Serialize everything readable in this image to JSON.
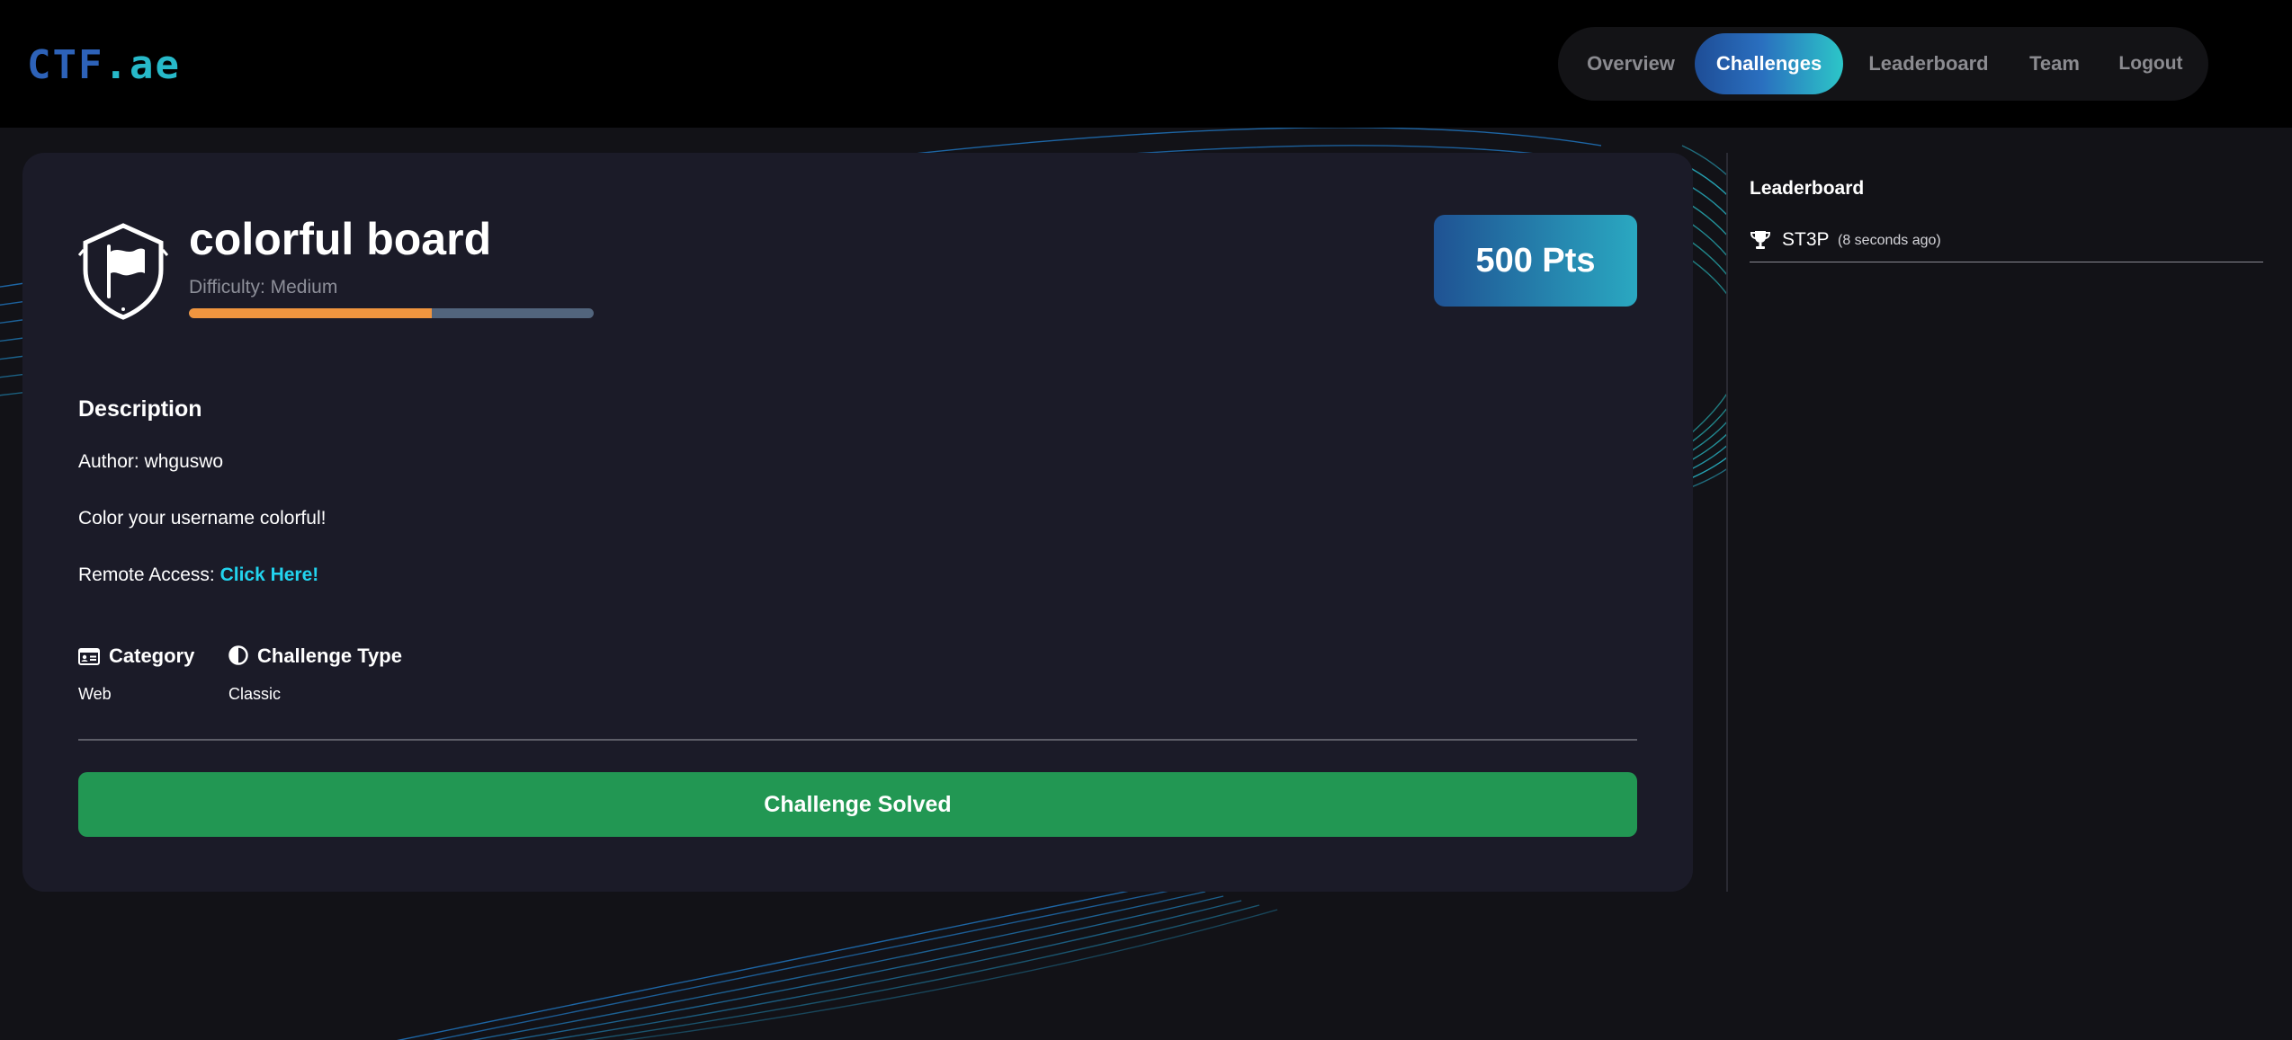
{
  "header": {
    "logo": {
      "part1": "CTF",
      "part2": ".ae"
    },
    "nav": [
      {
        "label": "Overview",
        "active": false
      },
      {
        "label": "Challenges",
        "active": true
      },
      {
        "label": "Leaderboard",
        "active": false
      },
      {
        "label": "Team",
        "active": false
      },
      {
        "label": "Logout",
        "active": false
      }
    ]
  },
  "challenge": {
    "icon": "shield-flag-icon",
    "title": "colorful board",
    "difficulty_text": "Difficulty: Medium",
    "difficulty_level_fraction": 0.6,
    "points": "500 Pts",
    "description_heading": "Description",
    "author_line": "Author: whguswo",
    "summary_line": "Color your username colorful!",
    "remote_access_label": "Remote Access: ",
    "remote_access_link": "Click Here!",
    "category_label": "Category",
    "category_icon": "id-card-icon",
    "category_value": "Web",
    "type_label": "Challenge Type",
    "type_icon": "half-circle-icon",
    "type_value": "Classic",
    "solved_button": "Challenge Solved"
  },
  "leaderboard": {
    "title": "Leaderboard",
    "entries": [
      {
        "icon": "trophy-icon",
        "name": "ST3P",
        "when": "(8 seconds ago)"
      }
    ]
  },
  "colors": {
    "accent_cyan": "#22d3ee",
    "difficulty_fill": "#f0953f",
    "solved_green": "#229753",
    "card_bg": "#1b1b28",
    "page_bg": "#121217"
  }
}
